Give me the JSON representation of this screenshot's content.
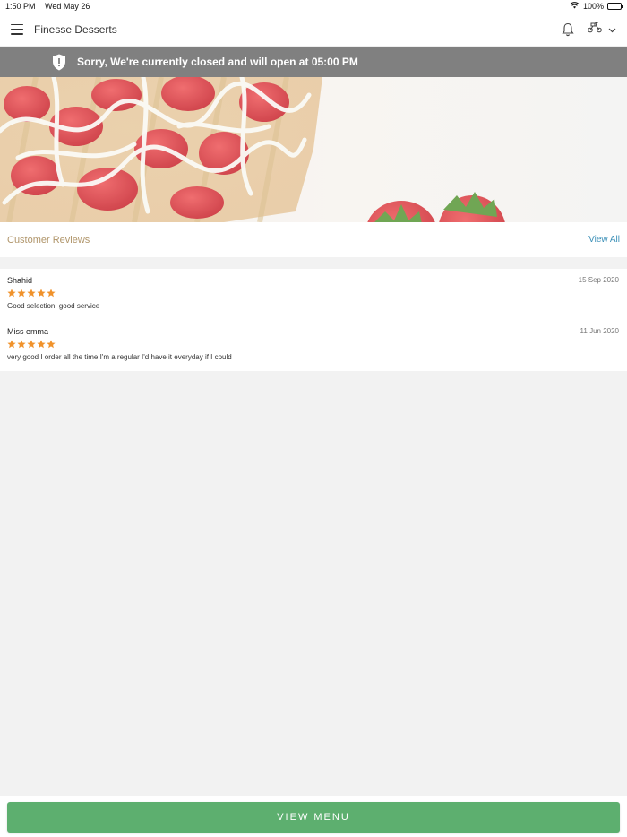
{
  "status_bar": {
    "time": "1:50 PM",
    "date": "Wed May 26",
    "battery": "100%"
  },
  "header": {
    "title": "Finesse Desserts"
  },
  "banner": {
    "message": "Sorry, We're currently closed and will open at 05:00 PM"
  },
  "reviews": {
    "title": "Customer Reviews",
    "view_all_label": "View All",
    "items": [
      {
        "name": "Shahid",
        "date": "15 Sep 2020",
        "rating": 5,
        "text": "Good selection, good service"
      },
      {
        "name": "Miss emma",
        "date": "11 Jun 2020",
        "rating": 5,
        "text": "very good I order all the time I'm a regular I'd have it everyday if I could"
      }
    ]
  },
  "actions": {
    "view_menu_label": "VIEW MENU"
  },
  "colors": {
    "banner": "#808080",
    "accent_green": "#5daf6f",
    "link_blue": "#3a8fb7",
    "star": "#f0922b",
    "reviews_title": "#b0956a"
  },
  "icons": [
    "hamburger-menu-icon",
    "bell-icon",
    "scooter-icon",
    "chevron-down-icon",
    "shield-alert-icon",
    "star-icon",
    "wifi-icon",
    "battery-icon"
  ]
}
